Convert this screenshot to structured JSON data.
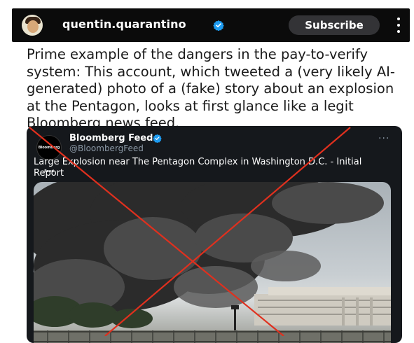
{
  "header": {
    "username": "quentin.quarantino",
    "subscribe_label": "Subscribe",
    "icons": [
      "avatar",
      "verified-badge-icon",
      "more-vertical-icon"
    ],
    "verified_color": "#1d9bf0"
  },
  "caption": {
    "text": "Prime example of the dangers in the pay-to-verify system: This account, which tweeted a (very likely AI-generated) photo of a (fake) story about an explosion at the Pentagon, looks at first glance like a legit Bloomberg news feed."
  },
  "tweet": {
    "account_name": "Bloomberg Feed",
    "handle": "@BloombergFeed",
    "avatar_text": "Bloomberg Feed",
    "more_glyph": "···",
    "text": "Large Explosion near The Pentagon Complex in Washington D.C. - Initial Report",
    "image": "photo of dark smoke plume near a large building",
    "overlay": "red-x",
    "overlay_color": "#e0301e"
  }
}
